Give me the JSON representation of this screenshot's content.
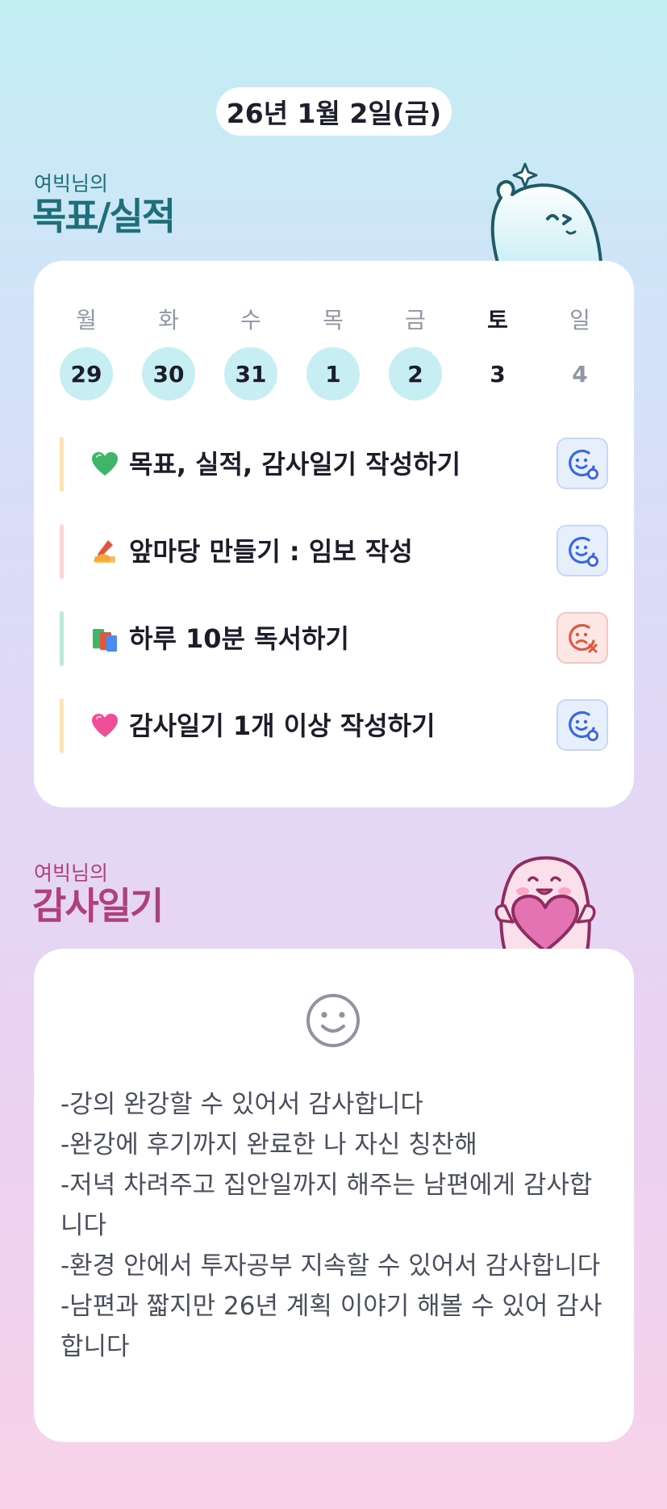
{
  "header": {
    "date": "26년 1월 2일(금)"
  },
  "goals_section": {
    "subtitle": "여빅님의",
    "title": "목표/실적",
    "weekdays": [
      "월",
      "화",
      "수",
      "목",
      "금",
      "토",
      "일"
    ],
    "days": [
      {
        "num": "29",
        "done": true
      },
      {
        "num": "30",
        "done": true
      },
      {
        "num": "31",
        "done": true
      },
      {
        "num": "1",
        "done": true
      },
      {
        "num": "2",
        "done": true
      },
      {
        "num": "3",
        "done": false
      },
      {
        "num": "4",
        "done": false
      }
    ],
    "goals": [
      {
        "icon": "green-heart-icon",
        "text": "목표, 실적, 감사일기 작성하기",
        "status": "achieved",
        "bar_color": "#fde2b8"
      },
      {
        "icon": "writing-hand-icon",
        "text": "앞마당 만들기 : 임보 작성",
        "status": "achieved",
        "bar_color": "#fbd6d6"
      },
      {
        "icon": "books-icon",
        "text": "하루 10분 독서하기",
        "status": "missed",
        "bar_color": "#bde9d8"
      },
      {
        "icon": "pink-heart-icon",
        "text": "감사일기 1개 이상 작성하기",
        "status": "achieved",
        "bar_color": "#fde2b8"
      }
    ],
    "colors": {
      "achieved": "#3768e6",
      "missed": "#e4553f",
      "done_day_bg": "#c7eef3"
    }
  },
  "diary_section": {
    "subtitle": "여빅님의",
    "title": "감사일기",
    "mood_icon": "neutral-smile-icon",
    "entries": [
      "-강의 완강할 수 있어서 감사합니다",
      "-완강에 후기까지 완료한 나 자신 칭찬해",
      "-저녁 차려주고 집안일까지 해주는 남편에게 감사합니다",
      "-환경 안에서 투자공부 지속할 수 있어서 감사합니다",
      "-남편과 짧지만 26년 계획 이야기 해볼 수 있어 감사합니다"
    ]
  }
}
